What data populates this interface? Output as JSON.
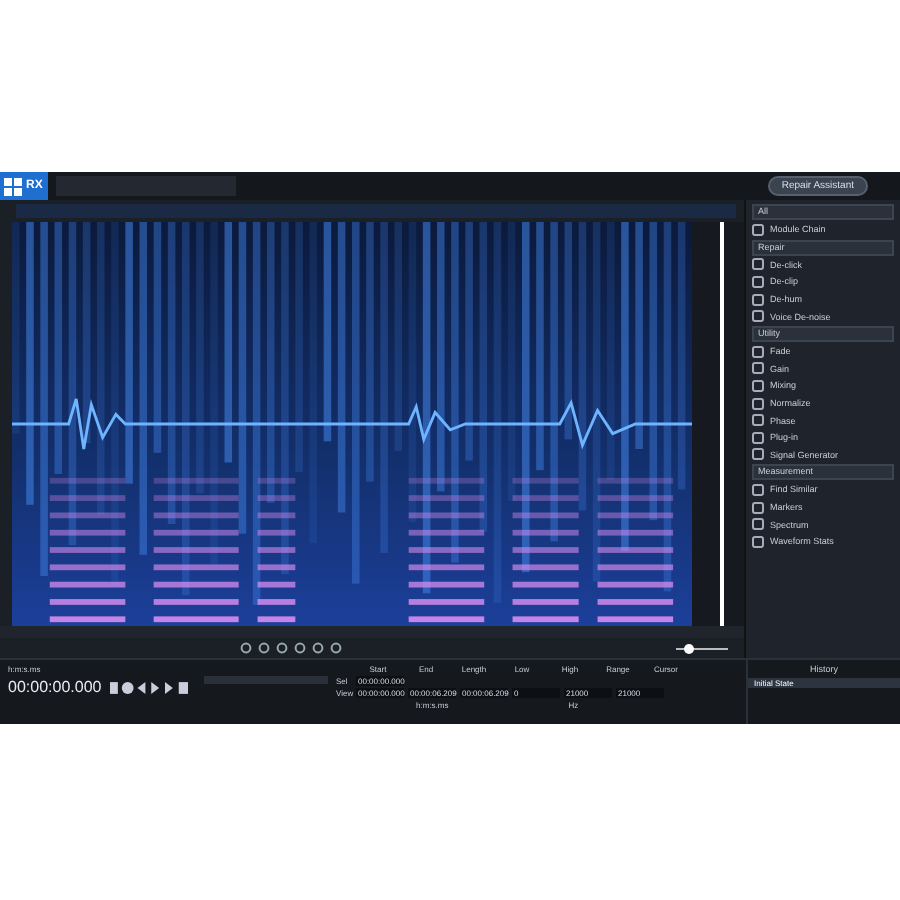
{
  "app": {
    "logo": "RX",
    "assistant_button": "Repair Assistant"
  },
  "zoom_slider": {
    "level": 0.25
  },
  "module_filter": "All",
  "modules": [
    {
      "kind": "module",
      "label": "Module Chain"
    },
    {
      "kind": "section",
      "label": "Repair"
    },
    {
      "kind": "module",
      "label": "De-click"
    },
    {
      "kind": "module",
      "label": "De-clip"
    },
    {
      "kind": "module",
      "label": "De-hum"
    },
    {
      "kind": "module",
      "label": "Voice De-noise"
    },
    {
      "kind": "section",
      "label": "Utility"
    },
    {
      "kind": "module",
      "label": "Fade"
    },
    {
      "kind": "module",
      "label": "Gain"
    },
    {
      "kind": "module",
      "label": "Mixing"
    },
    {
      "kind": "module",
      "label": "Normalize"
    },
    {
      "kind": "module",
      "label": "Phase"
    },
    {
      "kind": "module",
      "label": "Plug-in"
    },
    {
      "kind": "module",
      "label": "Signal Generator"
    },
    {
      "kind": "section",
      "label": "Measurement"
    },
    {
      "kind": "module",
      "label": "Find Similar"
    },
    {
      "kind": "module",
      "label": "Markers"
    },
    {
      "kind": "module",
      "label": "Spectrum"
    },
    {
      "kind": "module",
      "label": "Waveform Stats"
    }
  ],
  "transport": {
    "time_format": "h:m:s.ms",
    "time": "00:00:00.000"
  },
  "selection": {
    "columns": [
      "Start",
      "End",
      "Length",
      "Low",
      "High",
      "Range",
      "Cursor"
    ],
    "rows": [
      {
        "label": "Sel",
        "values": [
          "00:00:00.000"
        ]
      },
      {
        "label": "View",
        "values": [
          "00:00:00.000",
          "00:00:06.209",
          "00:00:06.209",
          "0",
          "21000",
          "21000"
        ]
      }
    ],
    "time_unit": "h:m:s.ms",
    "freq_unit": "Hz"
  },
  "history": {
    "title": "History",
    "items": [
      {
        "label": "Initial State",
        "selected": true
      }
    ]
  }
}
